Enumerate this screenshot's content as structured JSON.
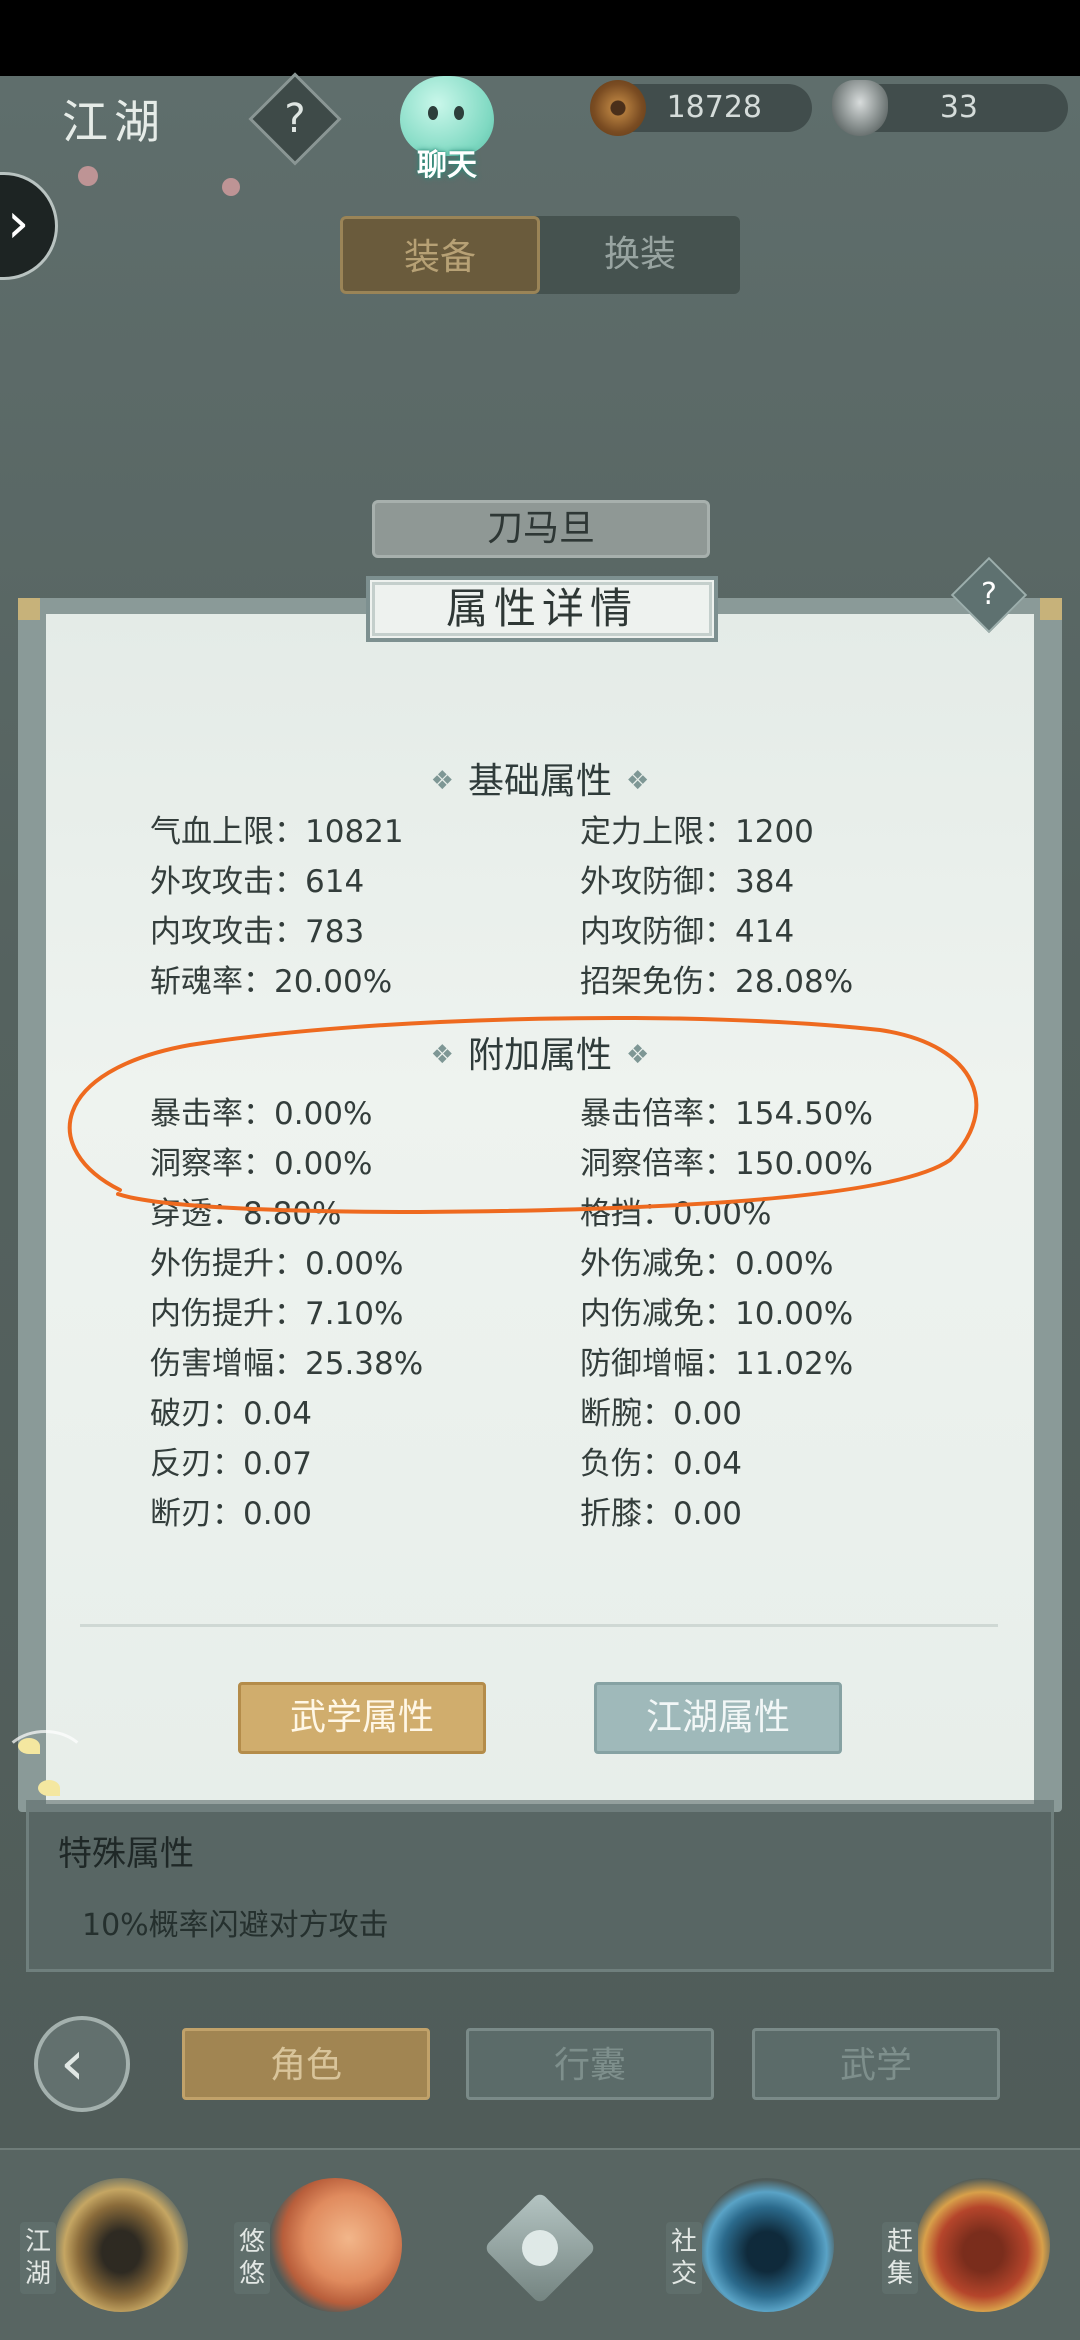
{
  "header": {
    "title": "江湖",
    "help_symbol": "?",
    "chat_label": "聊天",
    "coins": "18728",
    "silver": "33"
  },
  "equip_tabs": {
    "equip": "装备",
    "swap": "换装"
  },
  "character_name": "刀马旦",
  "panel": {
    "title": "属性详情",
    "help_symbol": "?",
    "basic_section": "基础属性",
    "extra_section": "附加属性",
    "section_marker": "❖",
    "basic_stats": [
      {
        "label": "气血上限：10821"
      },
      {
        "label": "定力上限：1200"
      },
      {
        "label": "外攻攻击：614"
      },
      {
        "label": "外攻防御：384"
      },
      {
        "label": "内攻攻击：783"
      },
      {
        "label": "内攻防御：414"
      },
      {
        "label": "斩魂率：20.00%"
      },
      {
        "label": "招架免伤：28.08%"
      }
    ],
    "extra_stats": [
      {
        "label": "暴击率：0.00%"
      },
      {
        "label": "暴击倍率：154.50%"
      },
      {
        "label": "洞察率：0.00%"
      },
      {
        "label": "洞察倍率：150.00%"
      },
      {
        "label": "穿透：8.80%"
      },
      {
        "label": "格挡：0.00%"
      },
      {
        "label": "外伤提升：0.00%"
      },
      {
        "label": "外伤减免：0.00%"
      },
      {
        "label": "内伤提升：7.10%"
      },
      {
        "label": "内伤减免：10.00%"
      },
      {
        "label": "伤害增幅：25.38%"
      },
      {
        "label": "防御增幅：11.02%"
      },
      {
        "label": "破刃：0.04"
      },
      {
        "label": "断腕：0.00"
      },
      {
        "label": "反刃：0.07"
      },
      {
        "label": "负伤：0.04"
      },
      {
        "label": "断刃：0.00"
      },
      {
        "label": "折膝：0.00"
      }
    ],
    "btn_martial": "武学属性",
    "btn_jianghu": "江湖属性"
  },
  "special": {
    "title": "特殊属性",
    "desc": "10%概率闪避对方攻击"
  },
  "nav_tabs": {
    "role": "角色",
    "bag": "行囊",
    "wuxue": "武学"
  },
  "bottom_nav": [
    {
      "label": "江湖",
      "icon": "straw-hat-icon"
    },
    {
      "label": "悠悠",
      "icon": "swallow-icon"
    },
    {
      "label": "社交",
      "icon": "wave-icon"
    },
    {
      "label": "赶集",
      "icon": "chest-icon"
    }
  ],
  "colors": {
    "annotation": "#ee6a1f",
    "gold_button": "#d0ad6d",
    "teal_button": "#9fb9ba"
  }
}
